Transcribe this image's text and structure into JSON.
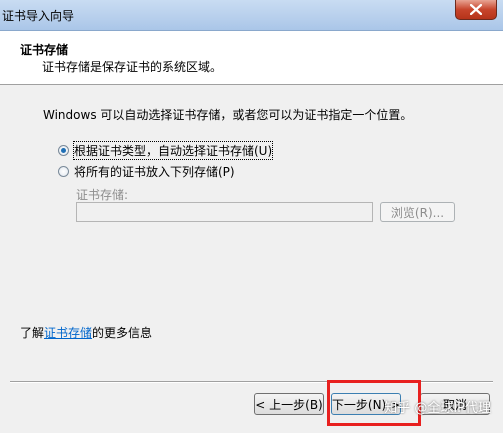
{
  "window": {
    "title": "证书导入向导",
    "close_icon": "close-icon"
  },
  "header": {
    "title": "证书存储",
    "subtitle": "证书存储是保存证书的系统区域。"
  },
  "body": {
    "description": "Windows 可以自动选择证书存储，或者您可以为证书指定一个位置。",
    "options": [
      {
        "label": "根据证书类型，自动选择证书存储(U)",
        "selected": true
      },
      {
        "label": "将所有的证书放入下列存储(P)",
        "selected": false
      }
    ],
    "store_label": "证书存储:",
    "store_value": "",
    "browse_label": "浏览(R)..."
  },
  "learn_more": {
    "prefix": "了解",
    "link": "证书存储",
    "suffix": "的更多信息"
  },
  "footer": {
    "back_label": "< 上一步(B)",
    "next_label": "下一步(N) >",
    "cancel_label": "取消"
  },
  "watermark": "知乎 @全球IP代理",
  "colors": {
    "link": "#0066cc",
    "highlight": "#e8201f",
    "radio_dot": "#1f6fb5"
  }
}
